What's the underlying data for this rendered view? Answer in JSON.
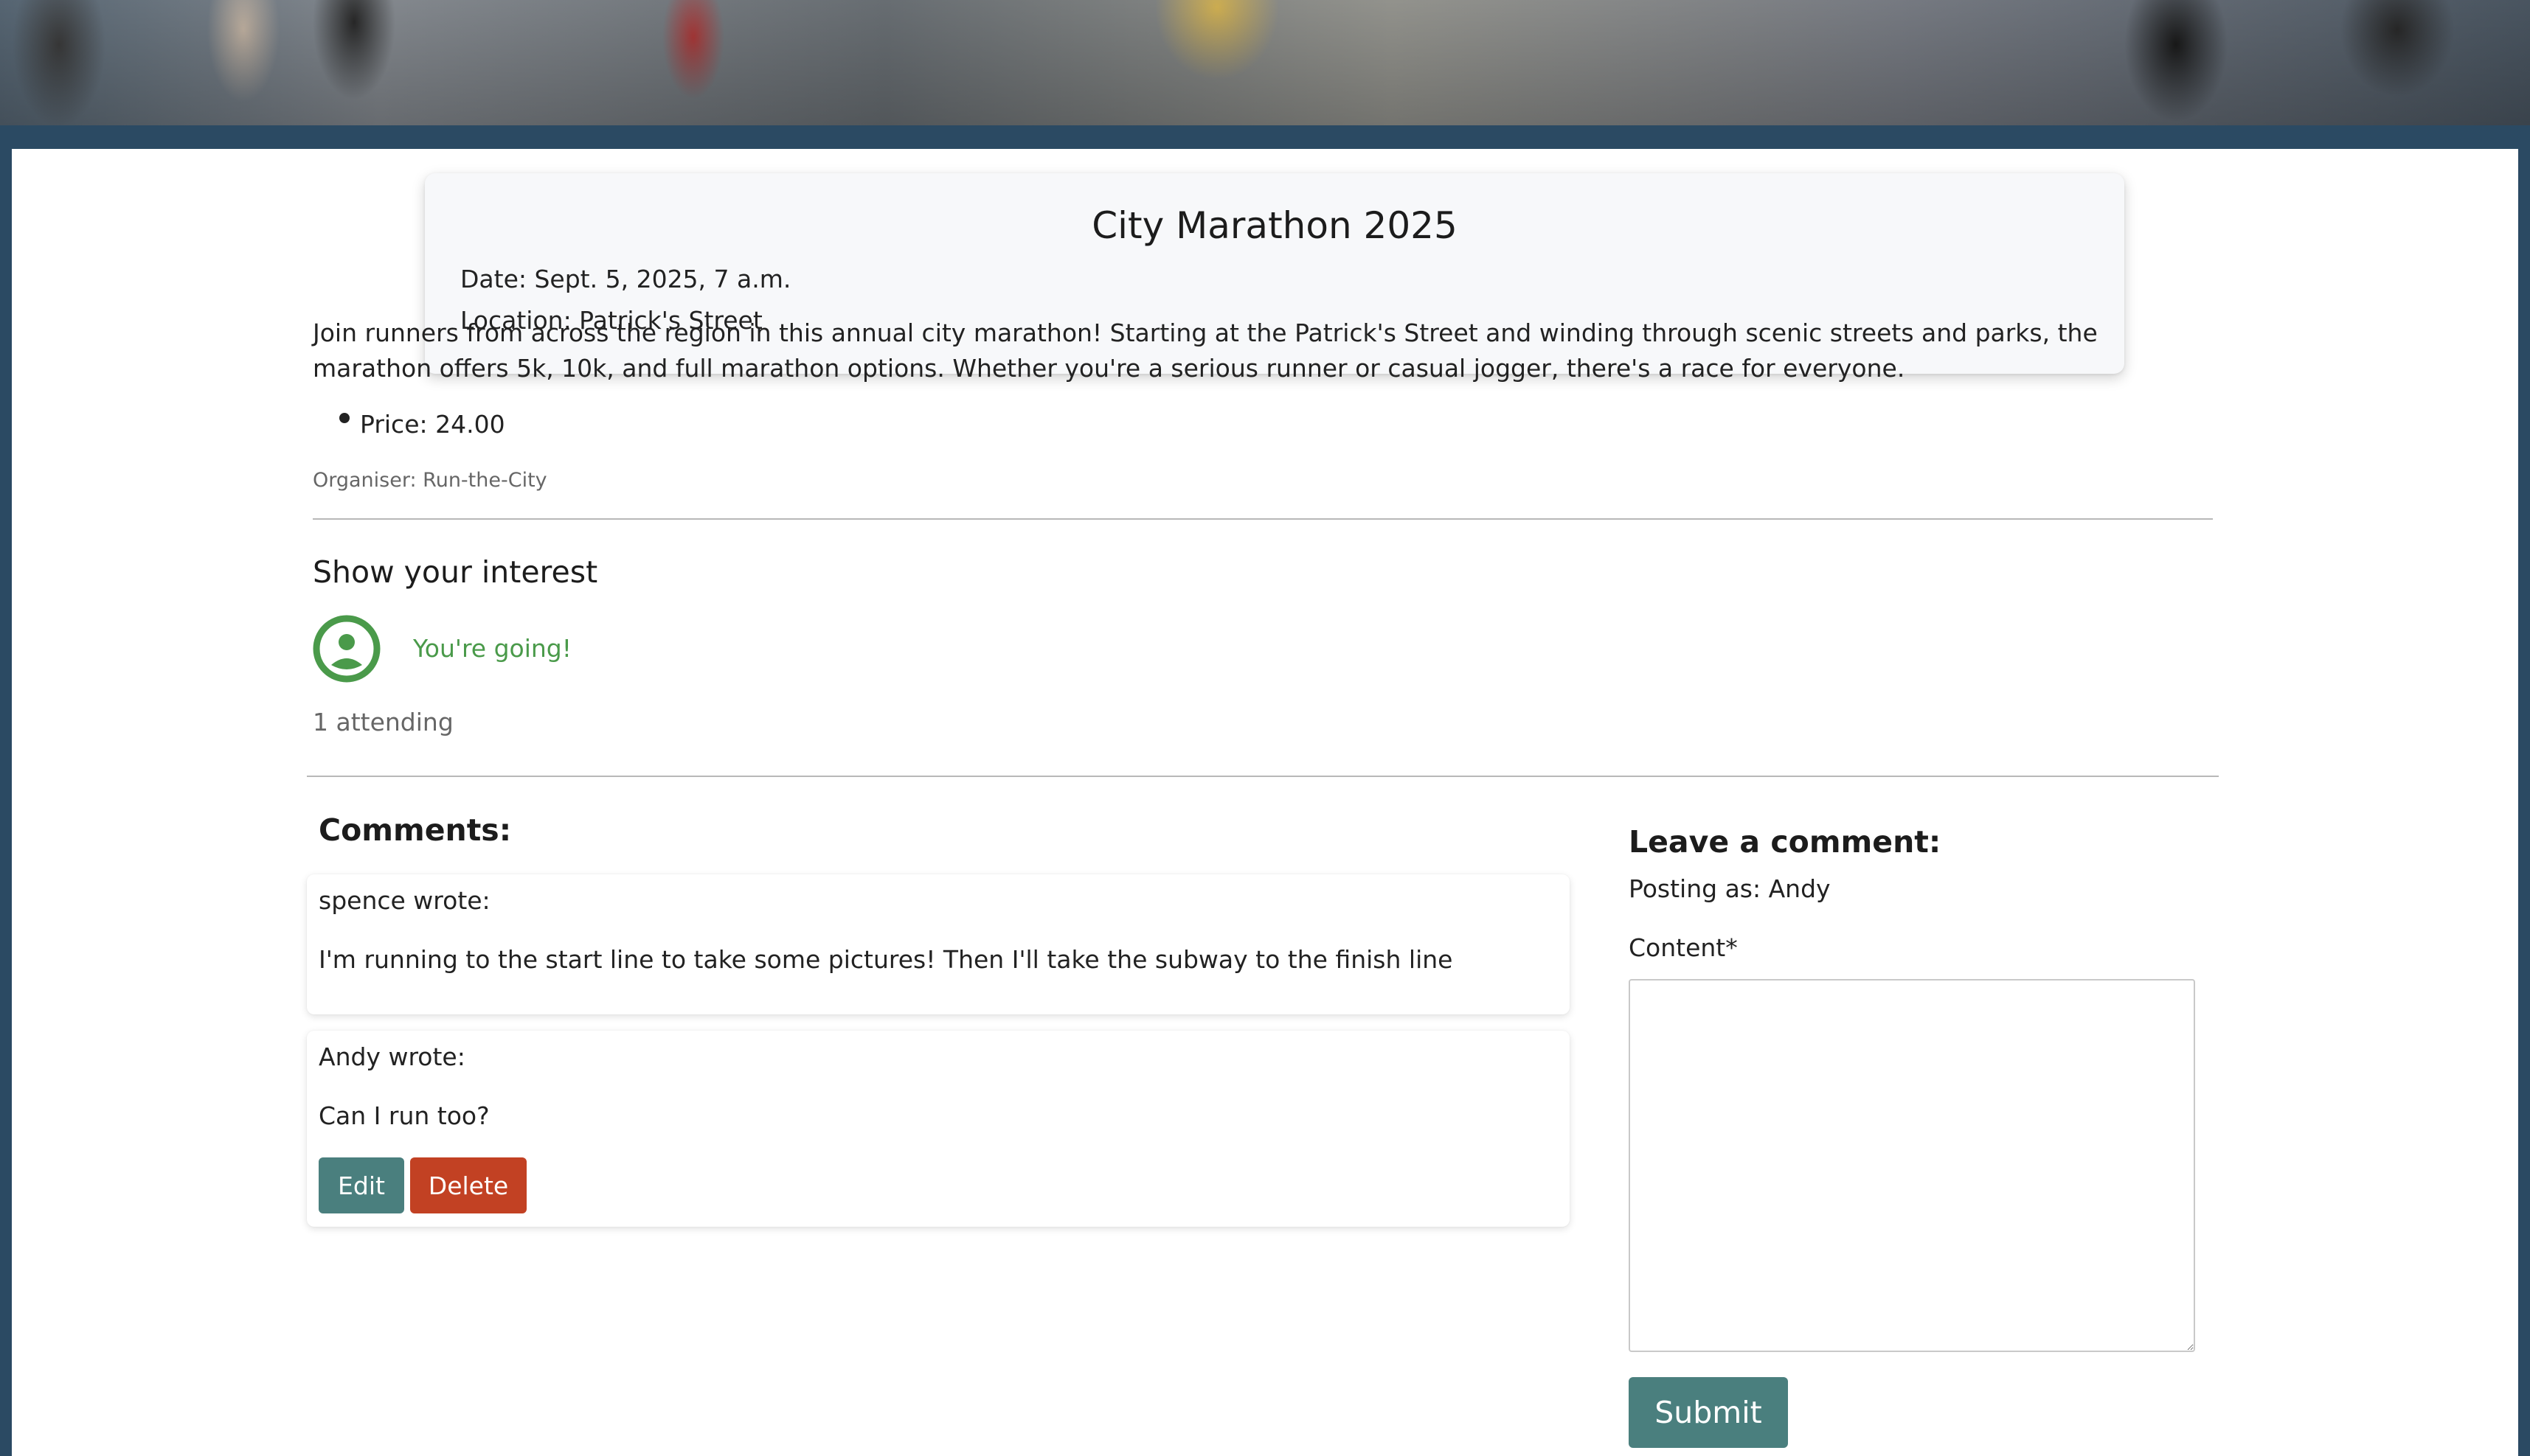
{
  "event": {
    "title": "City Marathon 2025",
    "date": "Date: Sept. 5, 2025, 7 a.m.",
    "location": "Location: Patrick's Street",
    "description": "Join runners from across the region in this annual city marathon! Starting at the Patrick's Street and winding through scenic streets and parks, the marathon offers 5k, 10k, and full marathon options. Whether you're a serious runner or casual jogger, there's a race for everyone.",
    "price": "Price: 24.00",
    "organiser": "Organiser: Run-the-City"
  },
  "interest": {
    "heading": "Show your interest",
    "status": "You're going!",
    "attending": "1 attending",
    "icon": "user-circle-icon",
    "status_color": "#4a9a4a"
  },
  "comments": {
    "heading": "Comments:",
    "items": [
      {
        "author": "spence wrote:",
        "body": "I'm running to the start line to take some pictures! Then I'll take the subway to the finish line"
      },
      {
        "author": "Andy wrote:",
        "body": "Can I run too?",
        "edit_label": "Edit",
        "delete_label": "Delete"
      }
    ]
  },
  "comment_form": {
    "heading": "Leave a comment:",
    "posting_as": "Posting as: Andy",
    "content_label": "Content*",
    "content_value": "",
    "submit_label": "Submit"
  },
  "colors": {
    "page_frame": "#2b4a63",
    "primary_button": "#4a7f7e",
    "danger_button": "#c24123"
  }
}
